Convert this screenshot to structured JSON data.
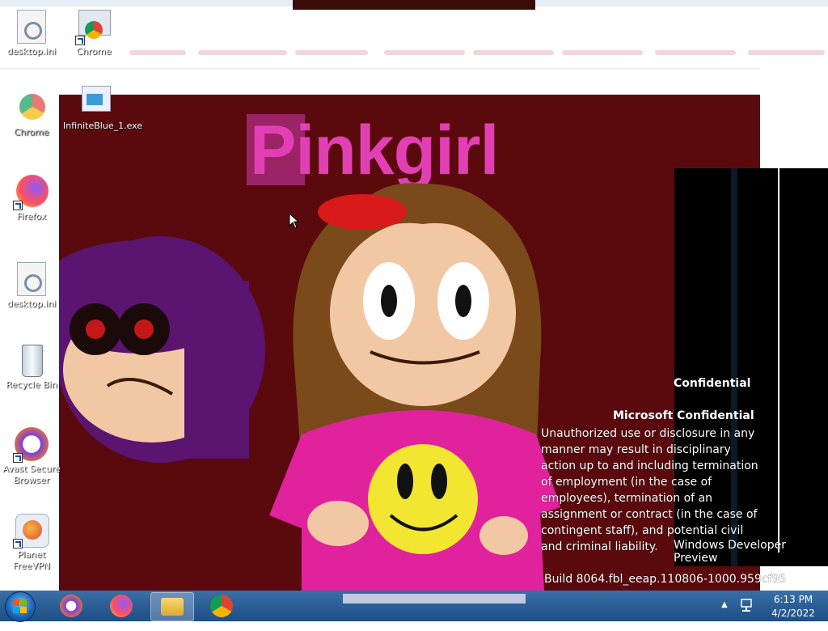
{
  "artwork": {
    "title": "Pinkgirl"
  },
  "desktop_icons": [
    {
      "name": "desktop-ini-icon-1",
      "label": "desktop.ini"
    },
    {
      "name": "chrome-icon",
      "label": "Chrome"
    },
    {
      "name": "chrome-extra-icon",
      "label": "Chrome"
    },
    {
      "name": "infiniteblue-icon",
      "label": "InfiniteBlue_1.exe"
    },
    {
      "name": "firefox-icon",
      "label": "Firefox"
    },
    {
      "name": "desktop-ini-icon-2",
      "label": "desktop.ini"
    },
    {
      "name": "recycle-bin-icon",
      "label": "Recycle Bin"
    },
    {
      "name": "avast-icon",
      "label": "Avast Secure Browser"
    },
    {
      "name": "planet-vpn-icon",
      "label": "Planet FreeVPN"
    }
  ],
  "watermark": {
    "confidential": "Confidential",
    "ms_confidential": "Microsoft Confidential",
    "body": "Unauthorized use or disclosure in any manner may result in disciplinary action up to and including termination of employment (in the case of employees), termination of an assignment or contract (in the case of contingent staff), and potential civil and criminal liability.",
    "windows_dev": "Windows Developer Preview",
    "build": "Build 8064.fbl_eeap.110806-1000.959cf95"
  },
  "taskbar": {
    "items": [
      "avast-browser",
      "firefox",
      "file-explorer",
      "chrome"
    ],
    "time": "6:13 PM",
    "date": "4/2/2022"
  },
  "colors": {
    "art_background": "#5a0a0d",
    "title_pink": "#e33fb5",
    "taskbar": "#1d4e86"
  }
}
